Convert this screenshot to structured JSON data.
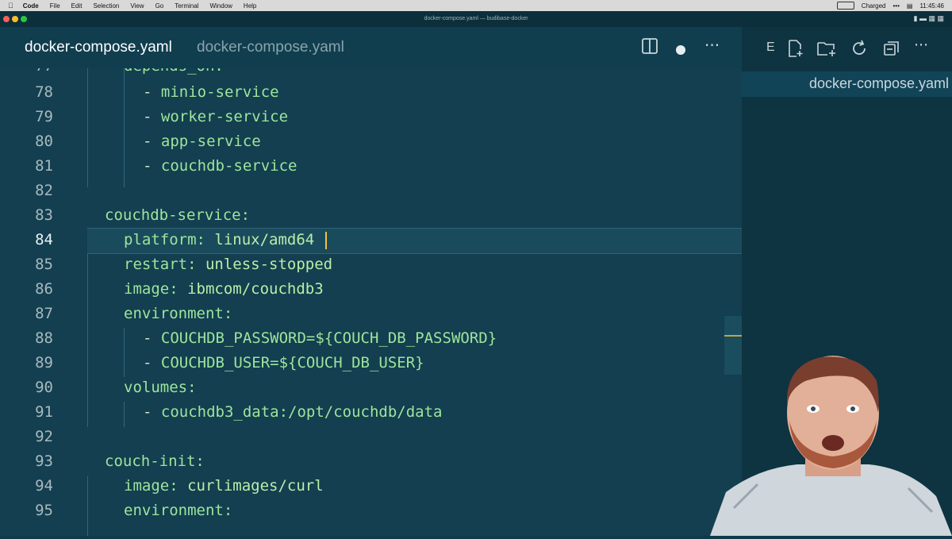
{
  "menubar": {
    "apple": "",
    "app": "Code",
    "items": [
      "File",
      "Edit",
      "Selection",
      "View",
      "Go",
      "Terminal",
      "Window",
      "Help"
    ],
    "battery": "Charged",
    "time": "11:45:46"
  },
  "window": {
    "title": "docker-compose.yaml — budibase-docker"
  },
  "tab": {
    "filename": "docker-compose.yaml",
    "path": "docker-compose.yaml"
  },
  "right_panel": {
    "letter": "E",
    "open_file": "docker-compose.yaml"
  },
  "editor": {
    "current_line": 84,
    "lines": [
      {
        "n": "78",
        "indent": 2,
        "dash": "- ",
        "text": "minio-service"
      },
      {
        "n": "79",
        "indent": 2,
        "dash": "- ",
        "text": "worker-service"
      },
      {
        "n": "80",
        "indent": 2,
        "dash": "- ",
        "text": "app-service"
      },
      {
        "n": "81",
        "indent": 2,
        "dash": "- ",
        "text": "couchdb-service"
      },
      {
        "n": "82",
        "indent": 0,
        "dash": "",
        "text": ""
      },
      {
        "n": "83",
        "indent": 0,
        "dash": "",
        "text": "couchdb-service:"
      },
      {
        "n": "84",
        "indent": 1,
        "dash": "",
        "text": "platform: linux/amd64"
      },
      {
        "n": "85",
        "indent": 1,
        "dash": "",
        "text": "restart: unless-stopped"
      },
      {
        "n": "86",
        "indent": 1,
        "dash": "",
        "text": "image: ibmcom/couchdb3"
      },
      {
        "n": "87",
        "indent": 1,
        "dash": "",
        "text": "environment:"
      },
      {
        "n": "88",
        "indent": 2,
        "dash": "- ",
        "text": "COUCHDB_PASSWORD=${COUCH_DB_PASSWORD}"
      },
      {
        "n": "89",
        "indent": 2,
        "dash": "- ",
        "text": "COUCHDB_USER=${COUCH_DB_USER}"
      },
      {
        "n": "90",
        "indent": 1,
        "dash": "",
        "text": "volumes:"
      },
      {
        "n": "91",
        "indent": 2,
        "dash": "- ",
        "text": "couchdb3_data:/opt/couchdb/data"
      },
      {
        "n": "92",
        "indent": 0,
        "dash": "",
        "text": ""
      },
      {
        "n": "93",
        "indent": 0,
        "dash": "",
        "text": "couch-init:"
      },
      {
        "n": "94",
        "indent": 1,
        "dash": "",
        "text": "image: curlimages/curl"
      },
      {
        "n": "95",
        "indent": 1,
        "dash": "",
        "text": "environment:"
      }
    ]
  }
}
